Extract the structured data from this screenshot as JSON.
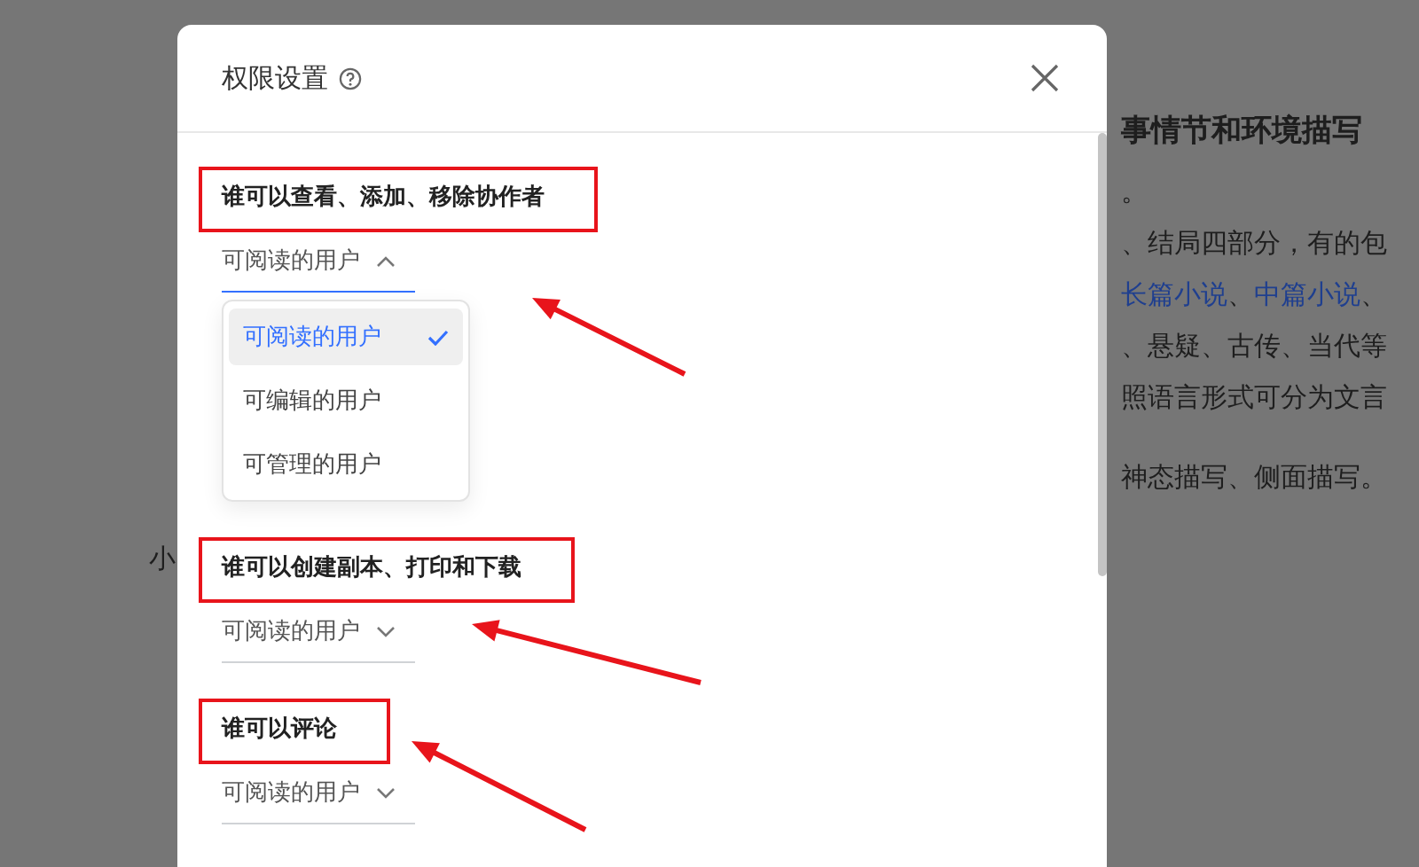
{
  "background_document": {
    "side_text": "小",
    "heading": "事情节和环境描写",
    "lines": [
      [
        {
          "text": "。",
          "link": false
        }
      ],
      [
        {
          "text": "、结局四部分，有的包",
          "link": false
        }
      ],
      [
        {
          "text": "长篇小说",
          "link": true
        },
        {
          "text": "、",
          "link": false
        },
        {
          "text": "中篇小说",
          "link": true
        },
        {
          "text": "、",
          "link": false
        }
      ],
      [
        {
          "text": "、悬疑、古传、当代等",
          "link": false
        }
      ],
      [
        {
          "text": "照语言形式可分为文言",
          "link": false
        }
      ]
    ],
    "last_line": "神态描写、侧面描写。"
  },
  "dialog": {
    "title": "权限设置",
    "sections": [
      {
        "label": "谁可以查看、添加、移除协作者",
        "value": "可阅读的用户",
        "expanded": true,
        "options": [
          {
            "label": "可阅读的用户",
            "selected": true
          },
          {
            "label": "可编辑的用户",
            "selected": false
          },
          {
            "label": "可管理的用户",
            "selected": false
          }
        ]
      },
      {
        "label": "谁可以创建副本、打印和下载",
        "value": "可阅读的用户",
        "expanded": false
      },
      {
        "label": "谁可以评论",
        "value": "可阅读的用户",
        "expanded": false
      }
    ]
  }
}
